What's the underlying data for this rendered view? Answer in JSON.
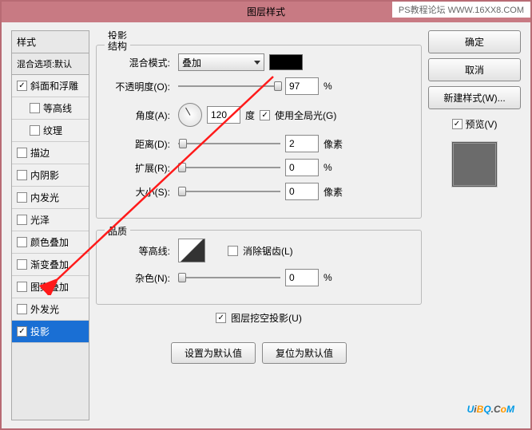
{
  "title": "图层样式",
  "watermark_top": "PS教程论坛 WWW.16XX8.COM",
  "styles_panel": {
    "header": "样式",
    "blend_default": "混合选项:默认",
    "items": [
      {
        "label": "斜面和浮雕",
        "checked": true,
        "indent": false
      },
      {
        "label": "等高线",
        "checked": false,
        "indent": true
      },
      {
        "label": "纹理",
        "checked": false,
        "indent": true
      },
      {
        "label": "描边",
        "checked": false,
        "indent": false
      },
      {
        "label": "内阴影",
        "checked": false,
        "indent": false
      },
      {
        "label": "内发光",
        "checked": false,
        "indent": false
      },
      {
        "label": "光泽",
        "checked": false,
        "indent": false
      },
      {
        "label": "颜色叠加",
        "checked": false,
        "indent": false
      },
      {
        "label": "渐变叠加",
        "checked": false,
        "indent": false
      },
      {
        "label": "图案叠加",
        "checked": false,
        "indent": false
      },
      {
        "label": "外发光",
        "checked": false,
        "indent": false
      },
      {
        "label": "投影",
        "checked": true,
        "indent": false,
        "selected": true
      }
    ]
  },
  "main": {
    "section_title": "投影",
    "structure": {
      "legend": "结构",
      "blend_mode_label": "混合模式:",
      "blend_mode_value": "叠加",
      "opacity_label": "不透明度(O):",
      "opacity_value": "97",
      "opacity_unit": "%",
      "angle_label": "角度(A):",
      "angle_value": "120",
      "angle_unit": "度",
      "global_light_label": "使用全局光(G)",
      "global_light_checked": true,
      "distance_label": "距离(D):",
      "distance_value": "2",
      "distance_unit": "像素",
      "spread_label": "扩展(R):",
      "spread_value": "0",
      "spread_unit": "%",
      "size_label": "大小(S):",
      "size_value": "0",
      "size_unit": "像素"
    },
    "quality": {
      "legend": "品质",
      "contour_label": "等高线:",
      "antialias_label": "消除锯齿(L)",
      "antialias_checked": false,
      "noise_label": "杂色(N):",
      "noise_value": "0",
      "noise_unit": "%"
    },
    "knockout_label": "图层挖空投影(U)",
    "knockout_checked": true,
    "btn_default": "设置为默认值",
    "btn_reset": "复位为默认值"
  },
  "right": {
    "ok": "确定",
    "cancel": "取消",
    "new_style": "新建样式(W)...",
    "preview_label": "预览(V)",
    "preview_checked": true
  }
}
